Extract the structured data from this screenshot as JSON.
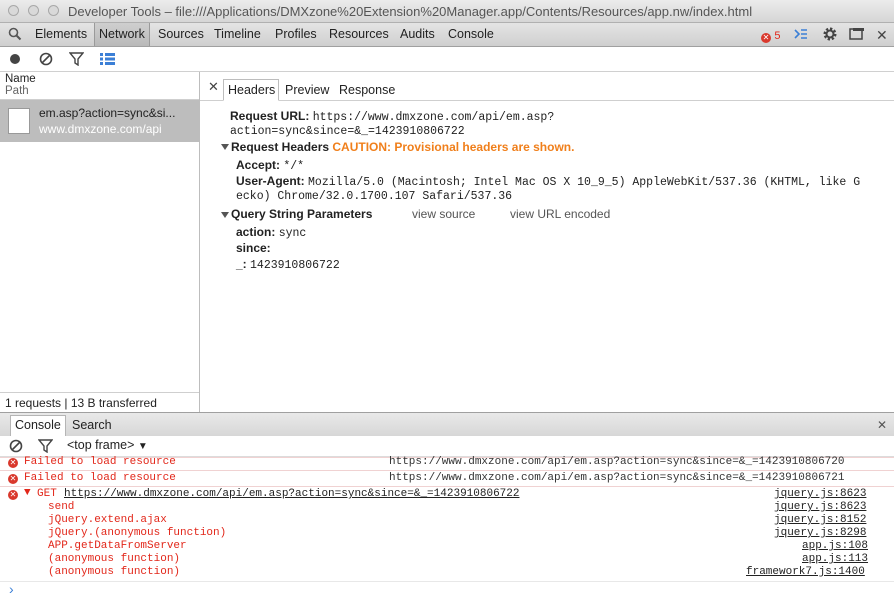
{
  "window": {
    "title": "Developer Tools – file:///Applications/DMXzone%20Extension%20Manager.app/Contents/Resources/app.nw/index.html"
  },
  "toolbar": {
    "tabs": [
      "Elements",
      "Network",
      "Sources",
      "Timeline",
      "Profiles",
      "Resources",
      "Audits",
      "Console"
    ],
    "active_tab": "Network",
    "error_count": "5"
  },
  "request_list": {
    "col_name": "Name",
    "col_path": "Path",
    "request_name": "em.asp?action=sync&si...",
    "request_domain": "www.dmxzone.com/api",
    "status": "1 requests | 13 B transferred"
  },
  "details": {
    "tabs": [
      "Headers",
      "Preview",
      "Response"
    ],
    "active_tab": "Headers",
    "request_url_label": "Request URL:",
    "request_url_line1": "https://www.dmxzone.com/api/em.asp?",
    "request_url_line2": "action=sync&since=&_=1423910806722",
    "request_headers_label": "Request Headers",
    "caution": "CAUTION: Provisional headers are shown.",
    "accept_key": "Accept:",
    "accept_val": "*/*",
    "ua_key": "User-Agent:",
    "ua_val_line1": "Mozilla/5.0 (Macintosh; Intel Mac OS X 10_9_5) AppleWebKit/537.36 (KHTML, like G",
    "ua_val_line2": "ecko) Chrome/32.0.1700.107 Safari/537.36",
    "qs_label": "Query String Parameters",
    "view_source": "view source",
    "view_url_encoded": "view URL encoded",
    "params": [
      {
        "key": "action:",
        "value": "sync"
      },
      {
        "key": "since:",
        "value": ""
      },
      {
        "key": "_:",
        "value": "1423910806722"
      }
    ]
  },
  "drawer": {
    "tabs": [
      "Console",
      "Search"
    ],
    "active_tab": "Console",
    "frame_selector": "<top frame>"
  },
  "console": {
    "messages": [
      {
        "text": "Failed to load resource",
        "url": "https://www.dmxzone.com/api/em.asp?action=sync&since=&_=1423910806720"
      },
      {
        "text": "Failed to load resource",
        "url": "https://www.dmxzone.com/api/em.asp?action=sync&since=&_=1423910806721"
      }
    ],
    "get_prefix": "GET",
    "get_url": "https://www.dmxzone.com/api/em.asp?action=sync&since=&_=1423910806722",
    "get_source": "jquery.js:8623",
    "stack": [
      {
        "fn": "send",
        "src": "jquery.js:8623"
      },
      {
        "fn": "jQuery.extend.ajax",
        "src": "jquery.js:8152"
      },
      {
        "fn": "jQuery.(anonymous function)",
        "src": "jquery.js:8298"
      },
      {
        "fn": "APP.getDataFromServer",
        "src": "app.js:108"
      },
      {
        "fn": "(anonymous function)",
        "src": "app.js:113"
      },
      {
        "fn": "(anonymous function)",
        "src": "framework7.js:1400"
      }
    ],
    "prompt": "›"
  },
  "colors": {
    "error": "#e2271a",
    "caution": "#f07f1b",
    "selected_row": "#bdbdbd",
    "blue_icon": "#3b7fd6"
  }
}
